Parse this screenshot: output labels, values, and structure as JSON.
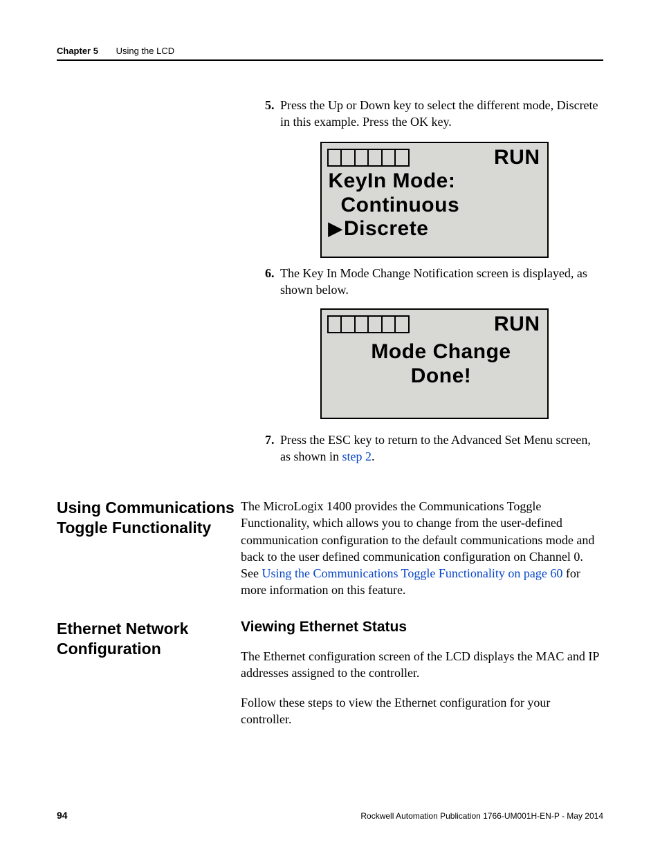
{
  "header": {
    "chapter_label": "Chapter 5",
    "chapter_title": "Using the LCD"
  },
  "steps": {
    "s5": {
      "num": "5",
      "text": "Press the Up or Down key to select the different mode, Discrete in this example. Press the OK key."
    },
    "s6": {
      "num": "6",
      "text": "The Key In Mode Change Notification screen is displayed, as shown below."
    },
    "s7": {
      "num": "7",
      "text_before_link": "Press the ESC key to return to the Advanced Set Menu screen, as shown in ",
      "link": "step 2",
      "text_after_link": "."
    }
  },
  "lcd1": {
    "status": "RUN",
    "line1": "KeyIn Mode:",
    "line2": "Continuous",
    "line3": "Discrete"
  },
  "lcd2": {
    "status": "RUN",
    "line1": "Mode Change",
    "line2": "Done!"
  },
  "sections": {
    "comm_toggle": {
      "heading": "Using Communications Toggle Functionality",
      "para_before_link": "The MicroLogix 1400 provides the Communications Toggle Functionality, which allows you to change from the user-defined communication configuration to the default communications mode and back to the user defined communication configuration on Channel 0. See ",
      "link": "Using the Communications Toggle Functionality on page 60",
      "para_after_link": " for more information on this feature."
    },
    "eth": {
      "heading": "Ethernet Network Configuration",
      "subheading": "Viewing Ethernet Status",
      "p1": "The Ethernet configuration screen of the LCD displays the MAC and IP addresses assigned to the controller.",
      "p2": "Follow these steps to view the Ethernet configuration for your controller."
    }
  },
  "footer": {
    "page": "94",
    "pub": "Rockwell Automation Publication 1766-UM001H-EN-P - May 2014"
  }
}
